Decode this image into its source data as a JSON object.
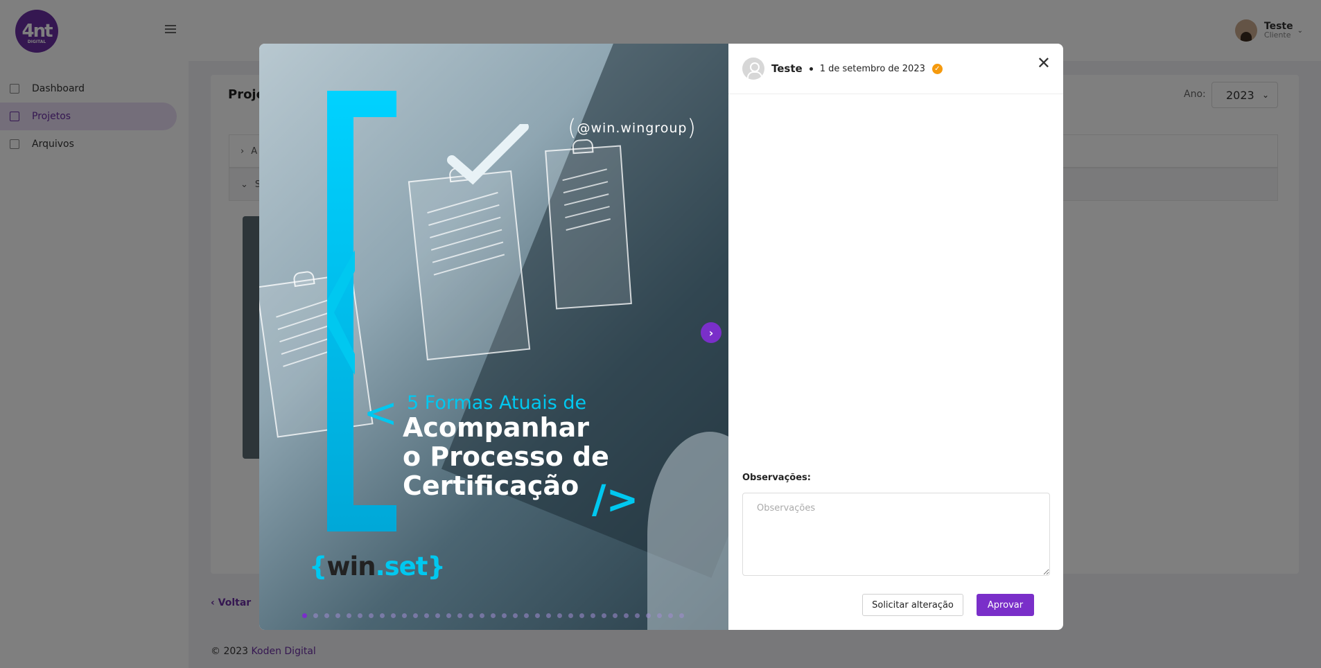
{
  "sidebar": {
    "logo_text": "4nt",
    "logo_sub": "DIGITAL",
    "items": [
      {
        "label": "Dashboard"
      },
      {
        "label": "Projetos"
      },
      {
        "label": "Arquivos"
      }
    ]
  },
  "user": {
    "name": "Teste",
    "role": "Cliente"
  },
  "page": {
    "title": "Projet",
    "year_label": "Ano:",
    "year_value": "2023",
    "accordion": [
      {
        "label": "A"
      },
      {
        "label": "S"
      }
    ],
    "back_label": "Voltar"
  },
  "footer": {
    "copyright": "© 2023 ",
    "brand": "Koden Digital"
  },
  "modal": {
    "media": {
      "handle": "@win.wingroup",
      "subtitle": "5 Formas Atuais de",
      "title_lines": [
        "Acompanhar",
        "o Processo de",
        "Certificação"
      ],
      "code_tag": "/>",
      "brand_brace_open": "{",
      "brand_win": "win",
      "brand_dot_set": ".set",
      "brand_brace_close": "}",
      "slide_count": 35,
      "active_slide": 1
    },
    "author": "Teste",
    "date": "1 de setembro de 2023",
    "status_icon": "check-badge-icon",
    "status_color": "#f59a0e",
    "obs_label": "Observações:",
    "obs_placeholder": "Observações",
    "obs_value": "",
    "request_change_label": "Solicitar alteração",
    "approve_label": "Aprovar",
    "accent_color": "#7a2fc9"
  }
}
